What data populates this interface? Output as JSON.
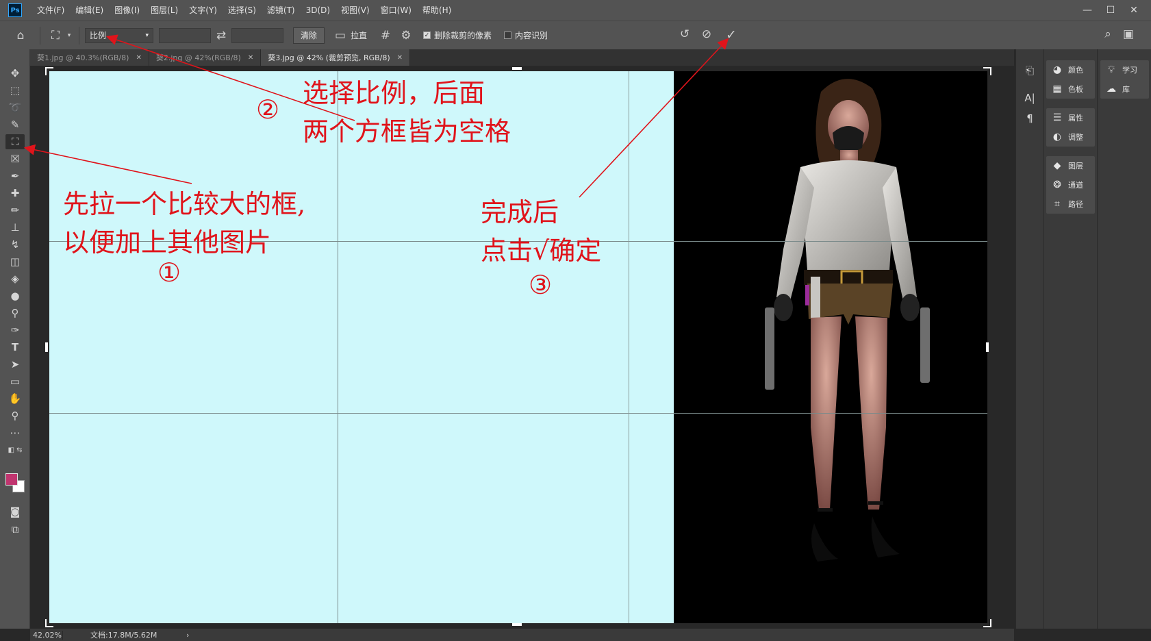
{
  "app": {
    "logo": "Ps"
  },
  "menu": [
    "文件(F)",
    "编辑(E)",
    "图像(I)",
    "图层(L)",
    "文字(Y)",
    "选择(S)",
    "滤镜(T)",
    "3D(D)",
    "视图(V)",
    "窗口(W)",
    "帮助(H)"
  ],
  "options": {
    "ratio_value": "比例",
    "clear_label": "清除",
    "straighten_label": "拉直",
    "delete_cropped_label": "删除裁剪的像素",
    "delete_cropped_checked": true,
    "content_aware_label": "内容识别",
    "content_aware_checked": false
  },
  "tabs": [
    {
      "label": "葵1.jpg @ 40.3%(RGB/8)",
      "active": false
    },
    {
      "label": "葵2.jpg @ 42%(RGB/8)",
      "active": false
    },
    {
      "label": "葵3.jpg @ 42% (裁剪预览, RGB/8)",
      "active": true
    }
  ],
  "annotations": {
    "step1_line1": "先拉一个比较大的框,",
    "step1_line2": "以便加上其他图片",
    "step1_num": "①",
    "step2_line1": "选择比例，后面",
    "step2_line2": "两个方框皆为空格",
    "step2_num": "②",
    "step3_line1": "完成后",
    "step3_line2": "点击√确定",
    "step3_num": "③"
  },
  "panels": {
    "main": [
      {
        "icon": "palette-icon",
        "label": "颜色"
      },
      {
        "icon": "swatches-icon",
        "label": "色板"
      },
      {
        "icon": "properties-icon",
        "label": "属性"
      },
      {
        "icon": "adjustments-icon",
        "label": "调整"
      },
      {
        "icon": "layers-icon",
        "label": "图层"
      },
      {
        "icon": "channels-icon",
        "label": "通道"
      },
      {
        "icon": "paths-icon",
        "label": "路径"
      }
    ],
    "learn": [
      {
        "icon": "lightbulb-icon",
        "label": "学习"
      },
      {
        "icon": "libraries-icon",
        "label": "库"
      }
    ]
  },
  "status": {
    "zoom": "42.02%",
    "doc_info": "文档:17.8M/5.62M"
  },
  "colors": {
    "foreground": "#c0356f",
    "background": "#ffffff",
    "canvas_fill": "#cff8fb",
    "annotation": "#e0141b"
  }
}
